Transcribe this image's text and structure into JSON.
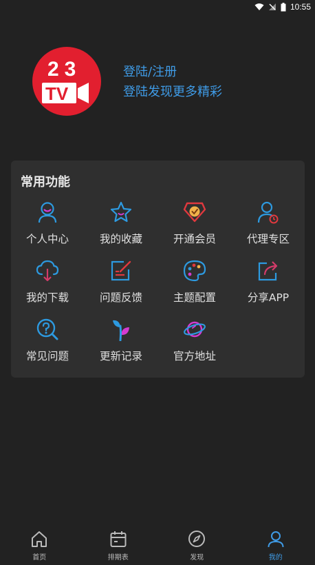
{
  "status_bar": {
    "time": "10:55"
  },
  "profile": {
    "logo_text_top": "23",
    "logo_text_bottom": "TV",
    "login_label": "登陆/注册",
    "login_subtitle": "登陆发现更多精彩"
  },
  "functions": {
    "title": "常用功能",
    "items": [
      {
        "label": "个人中心",
        "icon": "person-icon"
      },
      {
        "label": "我的收藏",
        "icon": "star-icon"
      },
      {
        "label": "开通会员",
        "icon": "vip-badge-icon"
      },
      {
        "label": "代理专区",
        "icon": "agent-icon"
      },
      {
        "label": "我的下载",
        "icon": "cloud-download-icon"
      },
      {
        "label": "问题反馈",
        "icon": "feedback-icon"
      },
      {
        "label": "主题配置",
        "icon": "palette-icon"
      },
      {
        "label": "分享APP",
        "icon": "share-icon"
      },
      {
        "label": "常见问题",
        "icon": "question-search-icon"
      },
      {
        "label": "更新记录",
        "icon": "sprout-icon"
      },
      {
        "label": "官方地址",
        "icon": "planet-icon"
      }
    ]
  },
  "bottom_nav": {
    "items": [
      {
        "label": "首页",
        "icon": "home-icon"
      },
      {
        "label": "排期表",
        "icon": "calendar-icon"
      },
      {
        "label": "发现",
        "icon": "compass-icon"
      },
      {
        "label": "我的",
        "icon": "user-icon",
        "active": true
      }
    ]
  },
  "colors": {
    "background": "#222222",
    "card": "#2f2f2f",
    "accent_blue": "#3f9be6",
    "logo_red": "#e21f2f"
  }
}
